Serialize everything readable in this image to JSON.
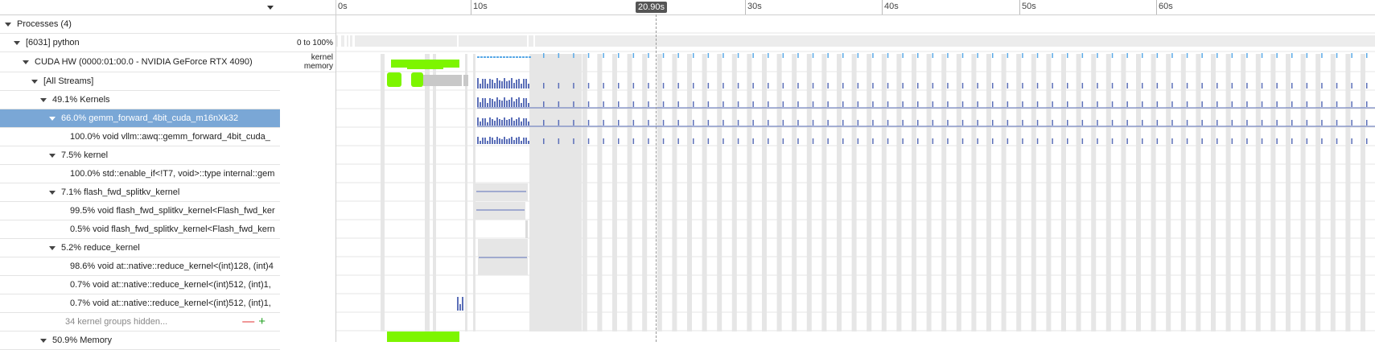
{
  "tree": {
    "rows": [
      {
        "label": "Processes (4)",
        "indent": 0,
        "expanded": true
      },
      {
        "label": "[6031] python",
        "indent": 1,
        "expanded": true
      },
      {
        "label": "CUDA HW (0000:01:00.0 - NVIDIA GeForce RTX 4090)",
        "indent": 2,
        "expanded": true
      },
      {
        "label": "[All Streams]",
        "indent": 3,
        "expanded": true
      },
      {
        "label": "49.1% Kernels",
        "indent": 4,
        "expanded": true
      },
      {
        "label": "66.0% gemm_forward_4bit_cuda_m16nXk32",
        "indent": 5,
        "expanded": true,
        "selected": true
      },
      {
        "label": "100.0% void vllm::awq::gemm_forward_4bit_cuda_",
        "indent": 6,
        "expanded": false
      },
      {
        "label": "7.5% kernel",
        "indent": 5,
        "expanded": true
      },
      {
        "label": "100.0% std::enable_if<!T7, void>::type internal::gem",
        "indent": 6,
        "expanded": false
      },
      {
        "label": "7.1% flash_fwd_splitkv_kernel",
        "indent": 5,
        "expanded": true
      },
      {
        "label": "99.5% void flash_fwd_splitkv_kernel<Flash_fwd_ker",
        "indent": 6,
        "expanded": false
      },
      {
        "label": "0.5% void flash_fwd_splitkv_kernel<Flash_fwd_kern",
        "indent": 6,
        "expanded": false
      },
      {
        "label": "5.2% reduce_kernel",
        "indent": 5,
        "expanded": true
      },
      {
        "label": "98.6% void at::native::reduce_kernel<(int)128, (int)4",
        "indent": 6,
        "expanded": false
      },
      {
        "label": "0.7% void at::native::reduce_kernel<(int)512, (int)1,",
        "indent": 6,
        "expanded": false
      },
      {
        "label": "0.7% void at::native::reduce_kernel<(int)512, (int)1,",
        "indent": 6,
        "expanded": false
      },
      {
        "label": "34 kernel groups hidden...",
        "indent": 5,
        "expanded": false,
        "hidden_groups": true
      },
      {
        "label": "50.9% Memory",
        "indent": 4,
        "expanded": true
      }
    ],
    "hidden_controls": {
      "minus": "—",
      "plus": "+"
    }
  },
  "labels": {
    "process_range": "0 to 100%",
    "cuda_kernel": "kernel",
    "cuda_memory": "memory"
  },
  "ruler": {
    "ticks": [
      "0s",
      "10s",
      "30s",
      "40s",
      "50s",
      "60s"
    ],
    "cursor": "20.90s"
  },
  "colors": {
    "selected_row": "#7aa7d6",
    "kernel_bar": "#5b6fb8",
    "memory_bar": "#7df500",
    "light_bar": "#5aa9e6",
    "idle_band": "#e6e6e6"
  }
}
